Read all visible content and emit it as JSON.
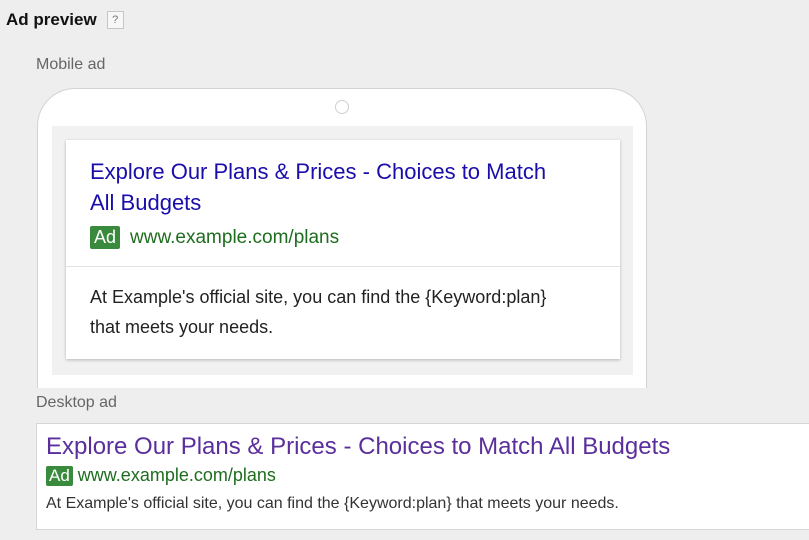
{
  "header": {
    "title": "Ad preview",
    "help_icon": "?"
  },
  "mobile": {
    "label": "Mobile ad",
    "headline": "Explore Our Plans & Prices - Choices to Match All Budgets",
    "badge": "Ad",
    "url": "www.example.com/plans",
    "description": "At Example's official site, you can find the {Keyword:plan} that meets your needs."
  },
  "desktop": {
    "label": "Desktop ad",
    "headline": "Explore Our Plans & Prices - Choices to Match All Budgets",
    "badge": "Ad",
    "url": "www.example.com/plans",
    "description": "At Example's official site, you can find the {Keyword:plan} that meets your needs."
  },
  "colors": {
    "mobile_headline": "#1a0dab",
    "desktop_headline": "#5a2f9c",
    "url_green": "#1e6d1e",
    "badge_green": "#3a8a3d"
  }
}
